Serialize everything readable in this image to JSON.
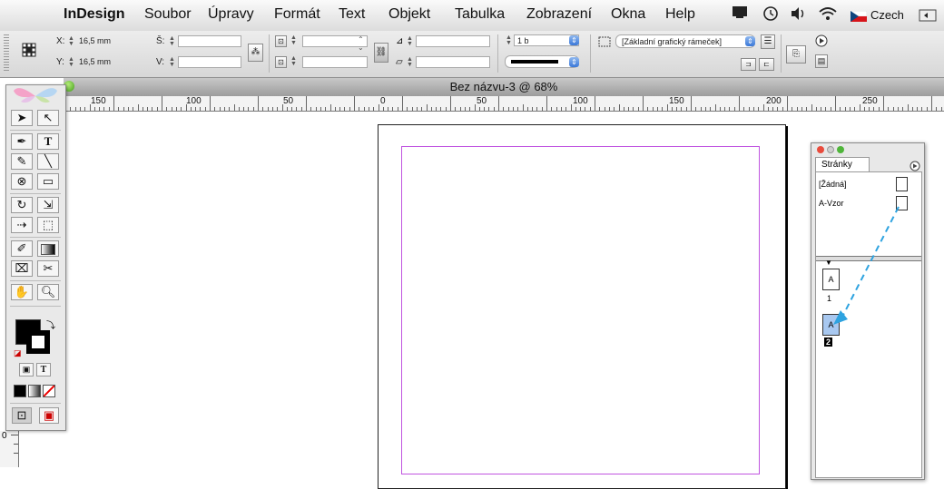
{
  "menubar": {
    "items": [
      "InDesign",
      "Soubor",
      "Úpravy",
      "Formát",
      "Text",
      "Objekt",
      "Tabulka",
      "Zobrazení",
      "Okna",
      "Help"
    ],
    "language": "Czech"
  },
  "control": {
    "x_label": "X:",
    "x_value": "16,5 mm",
    "y_label": "Y:",
    "y_value": "16,5 mm",
    "w_label": "Š:",
    "h_label": "V:",
    "stroke_weight": "1 b",
    "object_style": "[Základní grafický rámeček]"
  },
  "document": {
    "title": "Bez názvu-3 @ 68%",
    "ruler_labels": [
      "150",
      "100",
      "50",
      "0",
      "50",
      "100",
      "150",
      "200",
      "250"
    ],
    "vruler_label": "0"
  },
  "pages_panel": {
    "tab": "Stránky",
    "masters": [
      "[Žádná]",
      "A-Vzor"
    ],
    "pages": [
      {
        "prefix": "A",
        "number": "1"
      },
      {
        "prefix": "A",
        "number": "2"
      }
    ]
  },
  "colors": {
    "margin_guide": "#c055e0",
    "annotation_arrow": "#2ea3e0",
    "selected_page": "#a8c8f0"
  }
}
